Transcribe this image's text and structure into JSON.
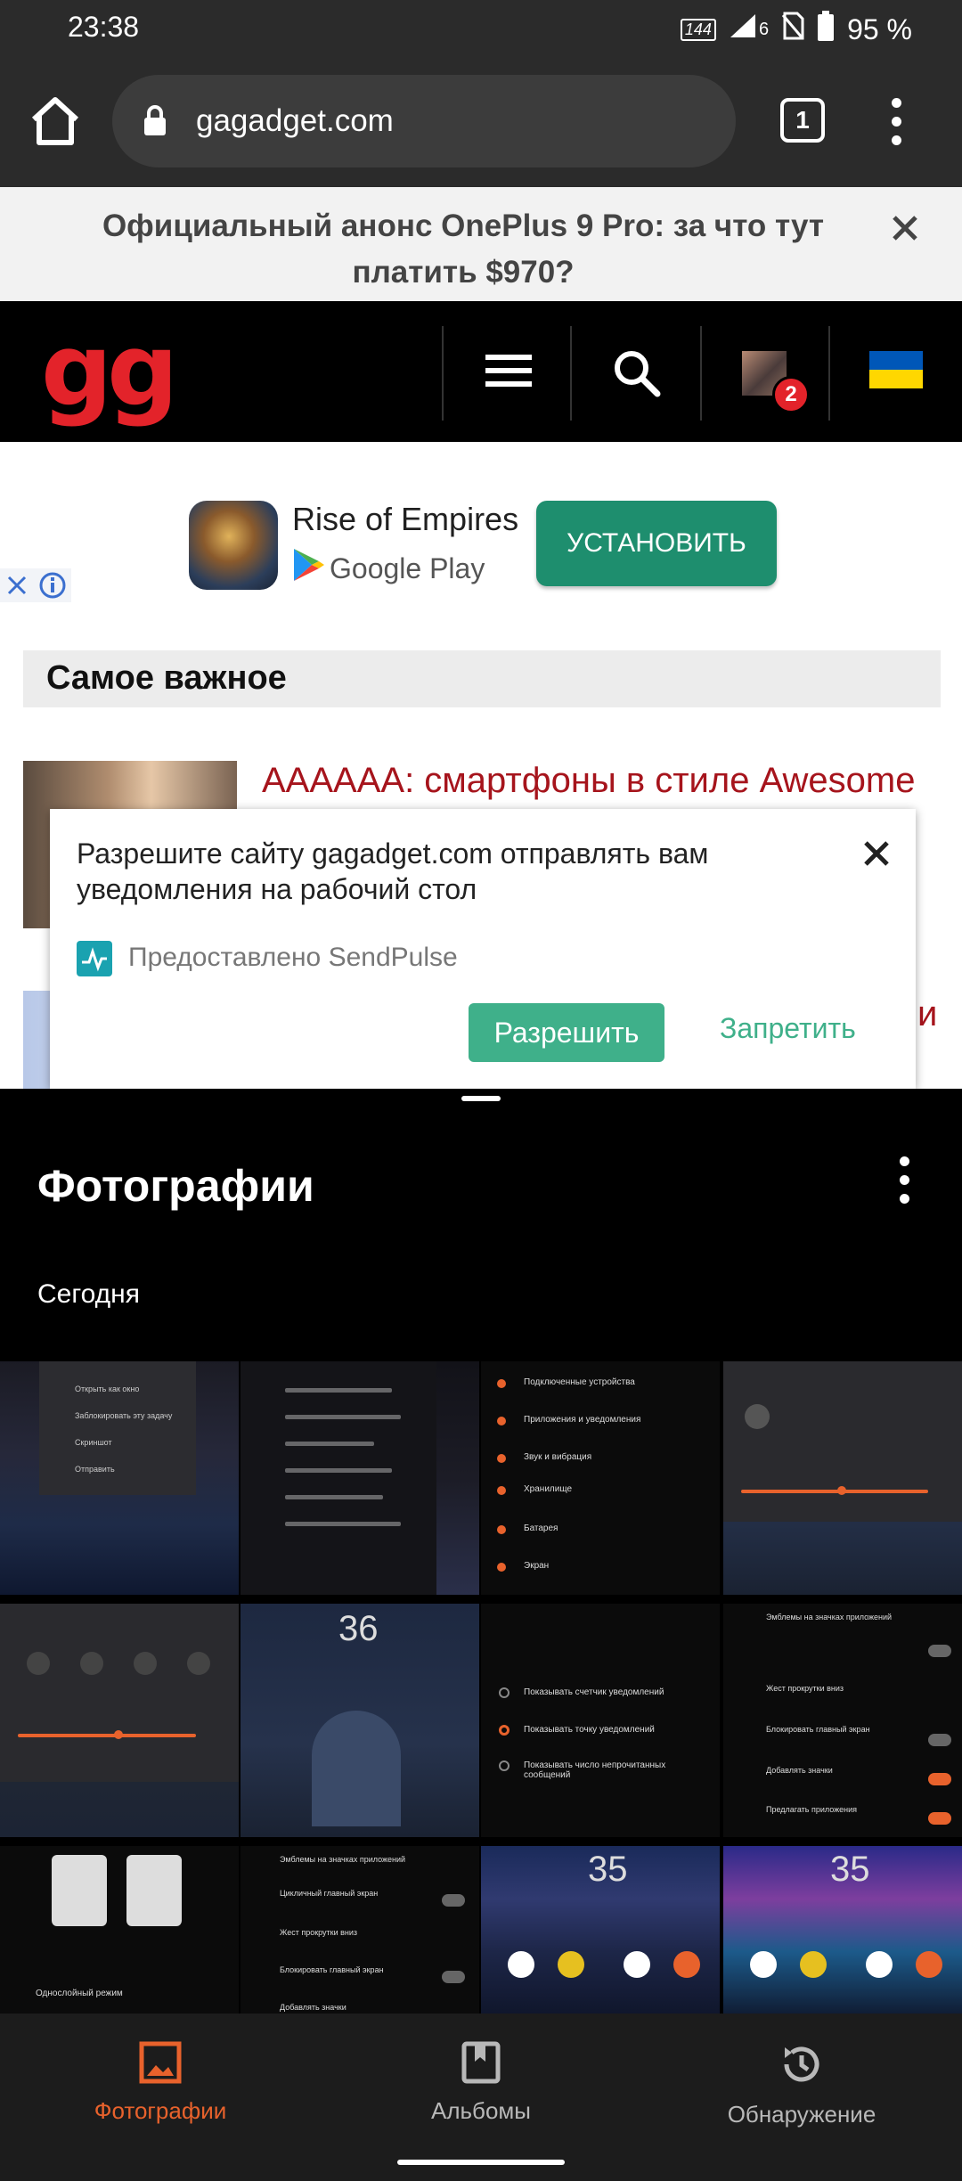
{
  "status_bar": {
    "time": "23:38",
    "refresh_rate": "144",
    "signal_label": "6",
    "battery": "95 %"
  },
  "browser": {
    "url": "gagadget.com",
    "tab_count": "1"
  },
  "announcement": {
    "text": "Официальный анонс OnePlus 9 Pro: за что тут платить $970?"
  },
  "site": {
    "logo": "gg",
    "notification_count": "2",
    "flag_colors": [
      "#0057b8",
      "#ffd700"
    ]
  },
  "ad": {
    "title": "Rise of Empires",
    "store": "Google Play",
    "install_label": "УСТАНОВИТЬ"
  },
  "content": {
    "section_title": "Самое важное",
    "article1_title": "АААААА: смартфоны в стиле Awesome",
    "article2_title_fragment": "и"
  },
  "notification_prompt": {
    "text": "Разрешите сайту gagadget.com отправлять вам уведомления на рабочий стол",
    "provider": "Предоставлено SendPulse",
    "allow": "Разрешить",
    "deny": "Запретить"
  },
  "photos": {
    "title": "Фотографии",
    "section": "Сегодня",
    "thumb_text": {
      "t1": [
        "Открыть как окно",
        "Заблокировать эту задачу",
        "Скриншот",
        "Отправить"
      ],
      "t3": [
        "Подключенные устройства",
        "Приложения и уведомления",
        "Звук и вибрация",
        "Хранилище",
        "Батарея",
        "Экран"
      ],
      "t5_clock": "36",
      "t7_options": [
        "Показывать счетчик уведомлений",
        "Показывать точку уведомлений",
        "Показывать число непрочитанных сообщений"
      ],
      "t8": [
        "Эмблемы на значках приложений",
        "Жест прокрутки вниз",
        "Блокировать главный экран",
        "Добавлять значки",
        "Предлагать приложения"
      ],
      "t9": "Однослойный режим",
      "t10": [
        "Эмблемы на значках приложений",
        "Цикличный главный экран",
        "Жест прокрутки вниз",
        "Блокировать главный экран",
        "Добавлять значки"
      ],
      "t11_clock": "35",
      "t12_clock": "35"
    }
  },
  "bottom_nav": {
    "items": [
      "Фотографии",
      "Альбомы",
      "Обнаружение"
    ],
    "accent": "#e8622c"
  }
}
